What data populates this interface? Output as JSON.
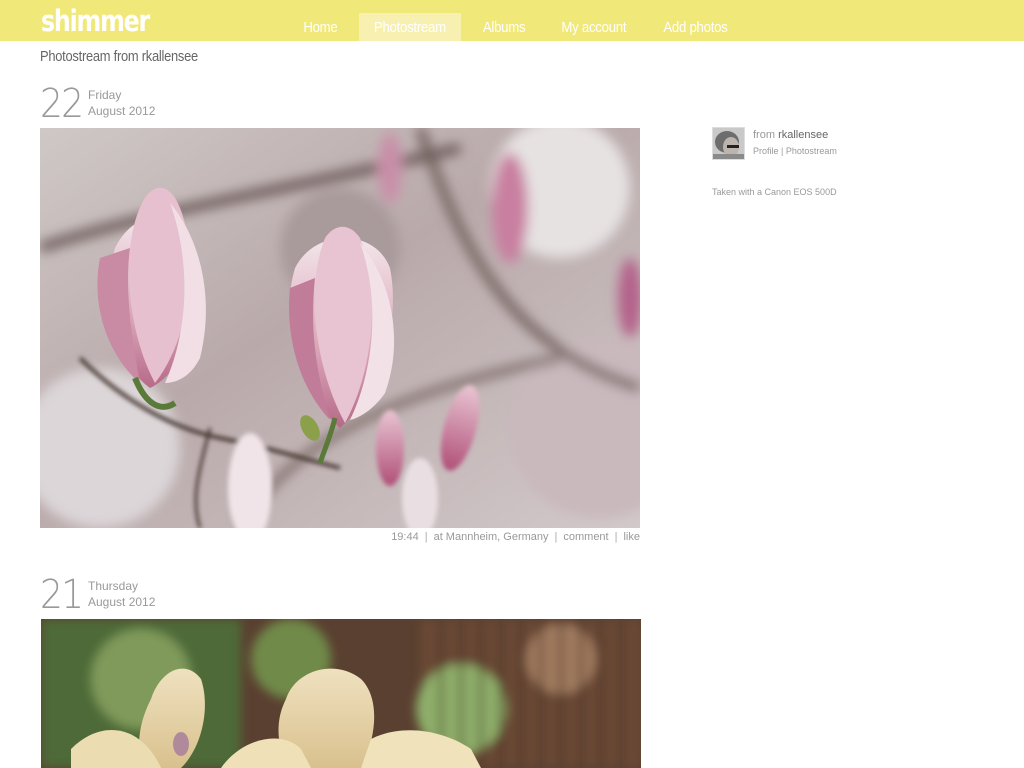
{
  "header": {
    "logo": "shimmer",
    "nav": [
      "Home",
      "Photostream",
      "Albums",
      "My account",
      "Add photos"
    ],
    "active_index": 1,
    "colors": {
      "bar": "#f1e87a",
      "active_tab": "#f7f0b0",
      "text": "#ffffff"
    }
  },
  "page": {
    "title": "Photostream from rkallensee"
  },
  "posts": [
    {
      "day": "22",
      "weekday": "Friday",
      "month_year": "August 2012",
      "meta": {
        "time": "19:44",
        "location": "at Mannheim, Germany",
        "comment": "comment",
        "like": "like"
      }
    },
    {
      "day": "21",
      "weekday": "Thursday",
      "month_year": "August 2012"
    }
  ],
  "sidebar": {
    "from_prefix": "from",
    "user": "rkallensee",
    "profile_link": "Profile",
    "separator": "|",
    "photostream_link": "Photostream",
    "camera": "Taken with a Canon EOS 500D"
  }
}
